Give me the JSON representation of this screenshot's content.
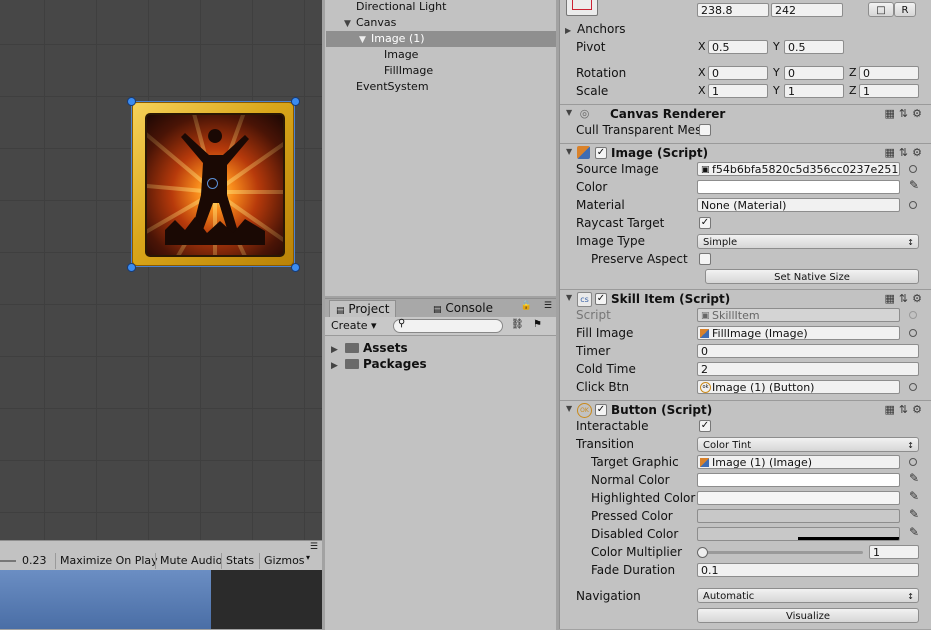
{
  "hierarchy": {
    "items": [
      {
        "label": "Directional Light"
      },
      {
        "label": "Canvas"
      },
      {
        "label": "Image (1)"
      },
      {
        "label": "Image"
      },
      {
        "label": "FillImage"
      },
      {
        "label": "EventSystem"
      }
    ]
  },
  "game_toolbar": {
    "scale_value": "0.23",
    "maximize": "Maximize On Play",
    "mute": "Mute Audio",
    "stats": "Stats",
    "gizmos": "Gizmos"
  },
  "project": {
    "tabs": [
      {
        "label": "Project"
      },
      {
        "label": "Console"
      }
    ],
    "create_label": "Create",
    "folders": [
      {
        "label": "Assets"
      },
      {
        "label": "Packages"
      }
    ]
  },
  "inspector": {
    "rect_transform": {
      "width": "238.8",
      "height": "242",
      "raw_button": "R",
      "anchors_label": "Anchors",
      "pivot_label": "Pivot",
      "pivot_x": "0.5",
      "pivot_y": "0.5",
      "rotation_label": "Rotation",
      "rotation_x": "0",
      "rotation_y": "0",
      "rotation_z": "0",
      "scale_label": "Scale",
      "scale_x": "1",
      "scale_y": "1",
      "scale_z": "1",
      "axis_x": "X",
      "axis_y": "Y",
      "axis_z": "Z"
    },
    "canvas_renderer": {
      "title": "Canvas Renderer",
      "cull_label": "Cull Transparent Mes"
    },
    "image": {
      "title": "Image (Script)",
      "source_image_label": "Source Image",
      "source_image_value": "f54b6bfa5820c5d356cc0237e251",
      "color_label": "Color",
      "material_label": "Material",
      "material_value": "None (Material)",
      "raycast_label": "Raycast Target",
      "image_type_label": "Image Type",
      "image_type_value": "Simple",
      "preserve_label": "Preserve Aspect",
      "native_size_button": "Set Native Size"
    },
    "skill_item": {
      "title": "Skill Item (Script)",
      "script_label": "Script",
      "script_value": "SkillItem",
      "fill_image_label": "Fill Image",
      "fill_image_value": "FillImage (Image)",
      "timer_label": "Timer",
      "timer_value": "0",
      "cold_time_label": "Cold Time",
      "cold_time_value": "2",
      "click_btn_label": "Click Btn",
      "click_btn_value": "Image (1) (Button)"
    },
    "button": {
      "title": "Button (Script)",
      "interactable_label": "Interactable",
      "transition_label": "Transition",
      "transition_value": "Color Tint",
      "target_graphic_label": "Target Graphic",
      "target_graphic_value": "Image (1) (Image)",
      "normal_color_label": "Normal Color",
      "highlighted_color_label": "Highlighted Color",
      "pressed_color_label": "Pressed Color",
      "disabled_color_label": "Disabled Color",
      "color_multiplier_label": "Color Multiplier",
      "color_multiplier_value": "1",
      "fade_duration_label": "Fade Duration",
      "fade_duration_value": "0.1",
      "navigation_label": "Navigation",
      "navigation_value": "Automatic",
      "visualize_button": "Visualize"
    }
  },
  "colors": {
    "panel_bg": "#c2c2c2",
    "scene_bg": "#474747",
    "selection": "#8f8f8f",
    "handle_blue": "#3c8cf0",
    "frame_gold": "#d9a61a"
  }
}
